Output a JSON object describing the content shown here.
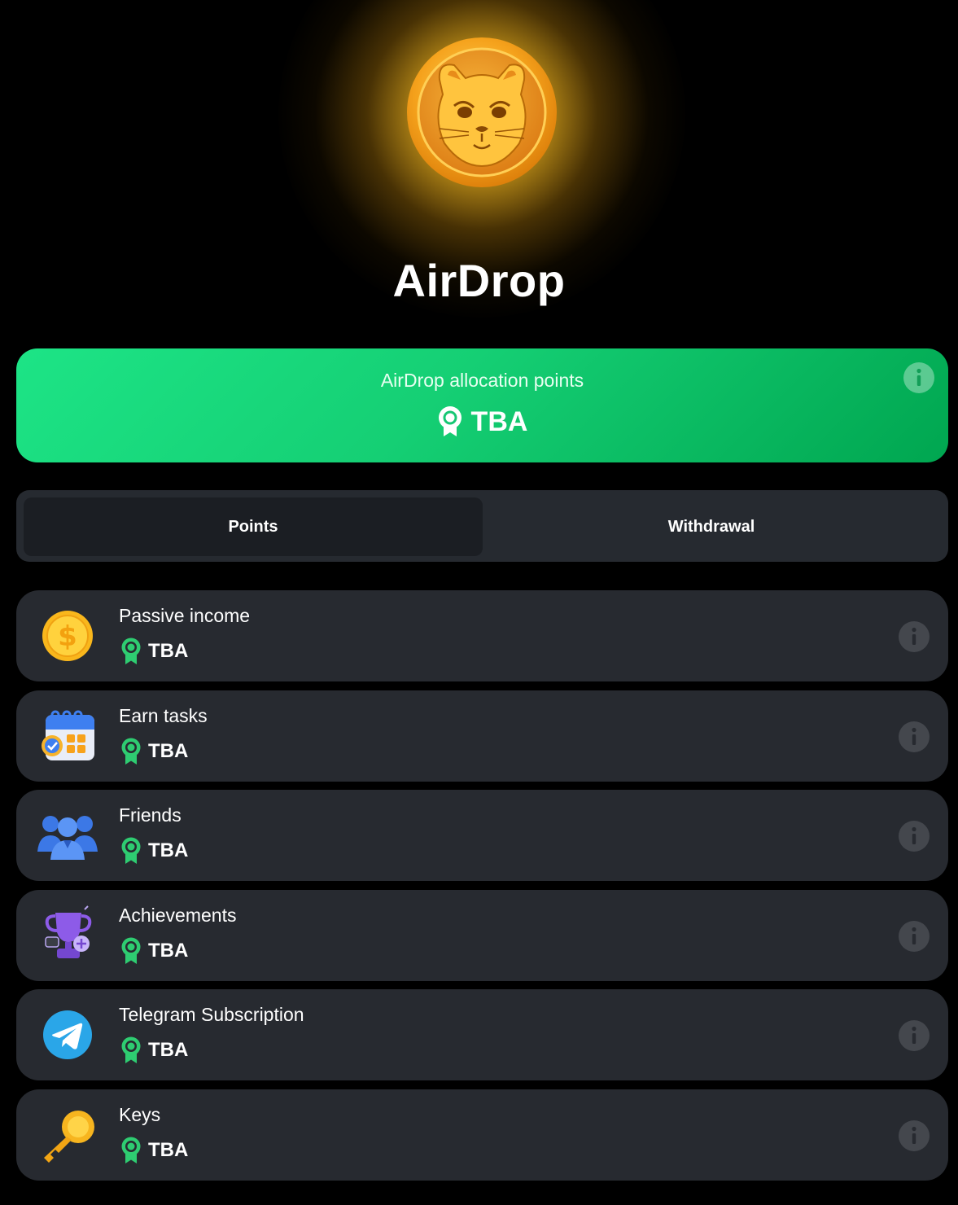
{
  "header": {
    "title": "AirDrop",
    "coin_icon": "hamster-coin-icon"
  },
  "allocation": {
    "label": "AirDrop allocation points",
    "value": "TBA",
    "badge_icon": "award-ribbon-icon",
    "info_icon": "info-icon"
  },
  "tabs": [
    {
      "label": "Points",
      "selected": true
    },
    {
      "label": "Withdrawal",
      "selected": false
    }
  ],
  "items": [
    {
      "label": "Passive income",
      "value": "TBA",
      "icon": "dollar-coin-icon"
    },
    {
      "label": "Earn tasks",
      "value": "TBA",
      "icon": "calendar-tasks-icon"
    },
    {
      "label": "Friends",
      "value": "TBA",
      "icon": "friends-group-icon"
    },
    {
      "label": "Achievements",
      "value": "TBA",
      "icon": "trophy-icon"
    },
    {
      "label": "Telegram Subscription",
      "value": "TBA",
      "icon": "telegram-icon"
    },
    {
      "label": "Keys",
      "value": "TBA",
      "icon": "key-icon"
    }
  ],
  "colors": {
    "background": "#000000",
    "accent_green": "#15cf74",
    "card_bg": "#272a30",
    "gold": "#f5a623",
    "ribbon_green": "#2ecc71"
  }
}
